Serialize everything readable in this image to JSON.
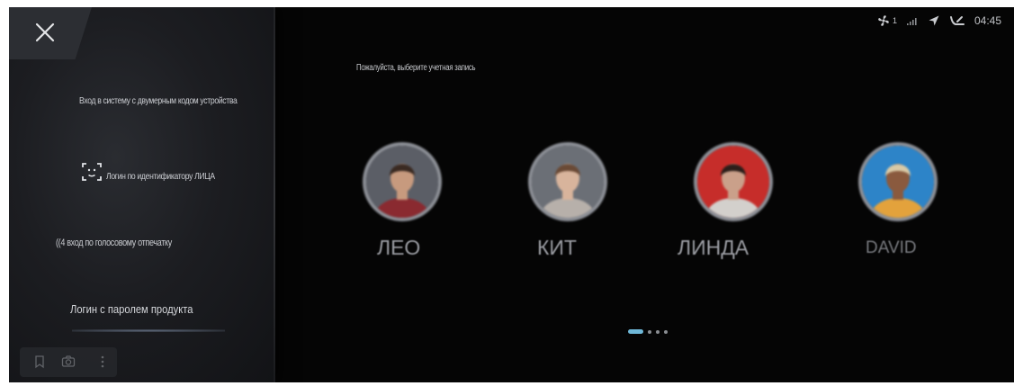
{
  "sidebar": {
    "close_icon": "close-icon",
    "options": {
      "qr_login": "Вход в систему с двумерным кодом устройства",
      "face_login": "Логин по идентификатору ЛИЦА",
      "voice_login": "((4 вход по голосовому отпечатку",
      "password_login": "Логин с паролем продукта"
    },
    "face_icon": "face-id-icon",
    "toolbar": {
      "icons": [
        "bookmark-icon",
        "camera-icon",
        "more-vertical-icon"
      ]
    }
  },
  "main": {
    "prompt": "Пожалуйста, выберите учетная запись",
    "status_bar": {
      "fan_level": "1",
      "time": "04:45",
      "icons": [
        "fan-icon",
        "signal-icon",
        "location-arrow-icon",
        "seat-recline-icon"
      ]
    },
    "users": [
      {
        "name": "ЛЕО",
        "colors": {
          "bg": "#5b5e66",
          "shirt": "#8a2a30",
          "skin": "#c79a7e",
          "hair": "#3a2a22"
        }
      },
      {
        "name": "КИТ",
        "colors": {
          "bg": "#6b6f76",
          "shirt": "#b7b0aa",
          "skin": "#d8b49c",
          "hair": "#6a4a36"
        }
      },
      {
        "name": "ЛИНДА",
        "colors": {
          "bg": "#c62d2a",
          "shirt": "#d3d0cc",
          "skin": "#caa08a",
          "hair": "#2b1e1a"
        }
      },
      {
        "name": "DAVID",
        "colors": {
          "bg": "#2d84c8",
          "shirt": "#e3a23c",
          "skin": "#8a5a3e",
          "hair": "#d8c9a6"
        }
      }
    ],
    "pager": {
      "pages": 4,
      "current": 1,
      "active_color": "#6fb8d8"
    }
  }
}
